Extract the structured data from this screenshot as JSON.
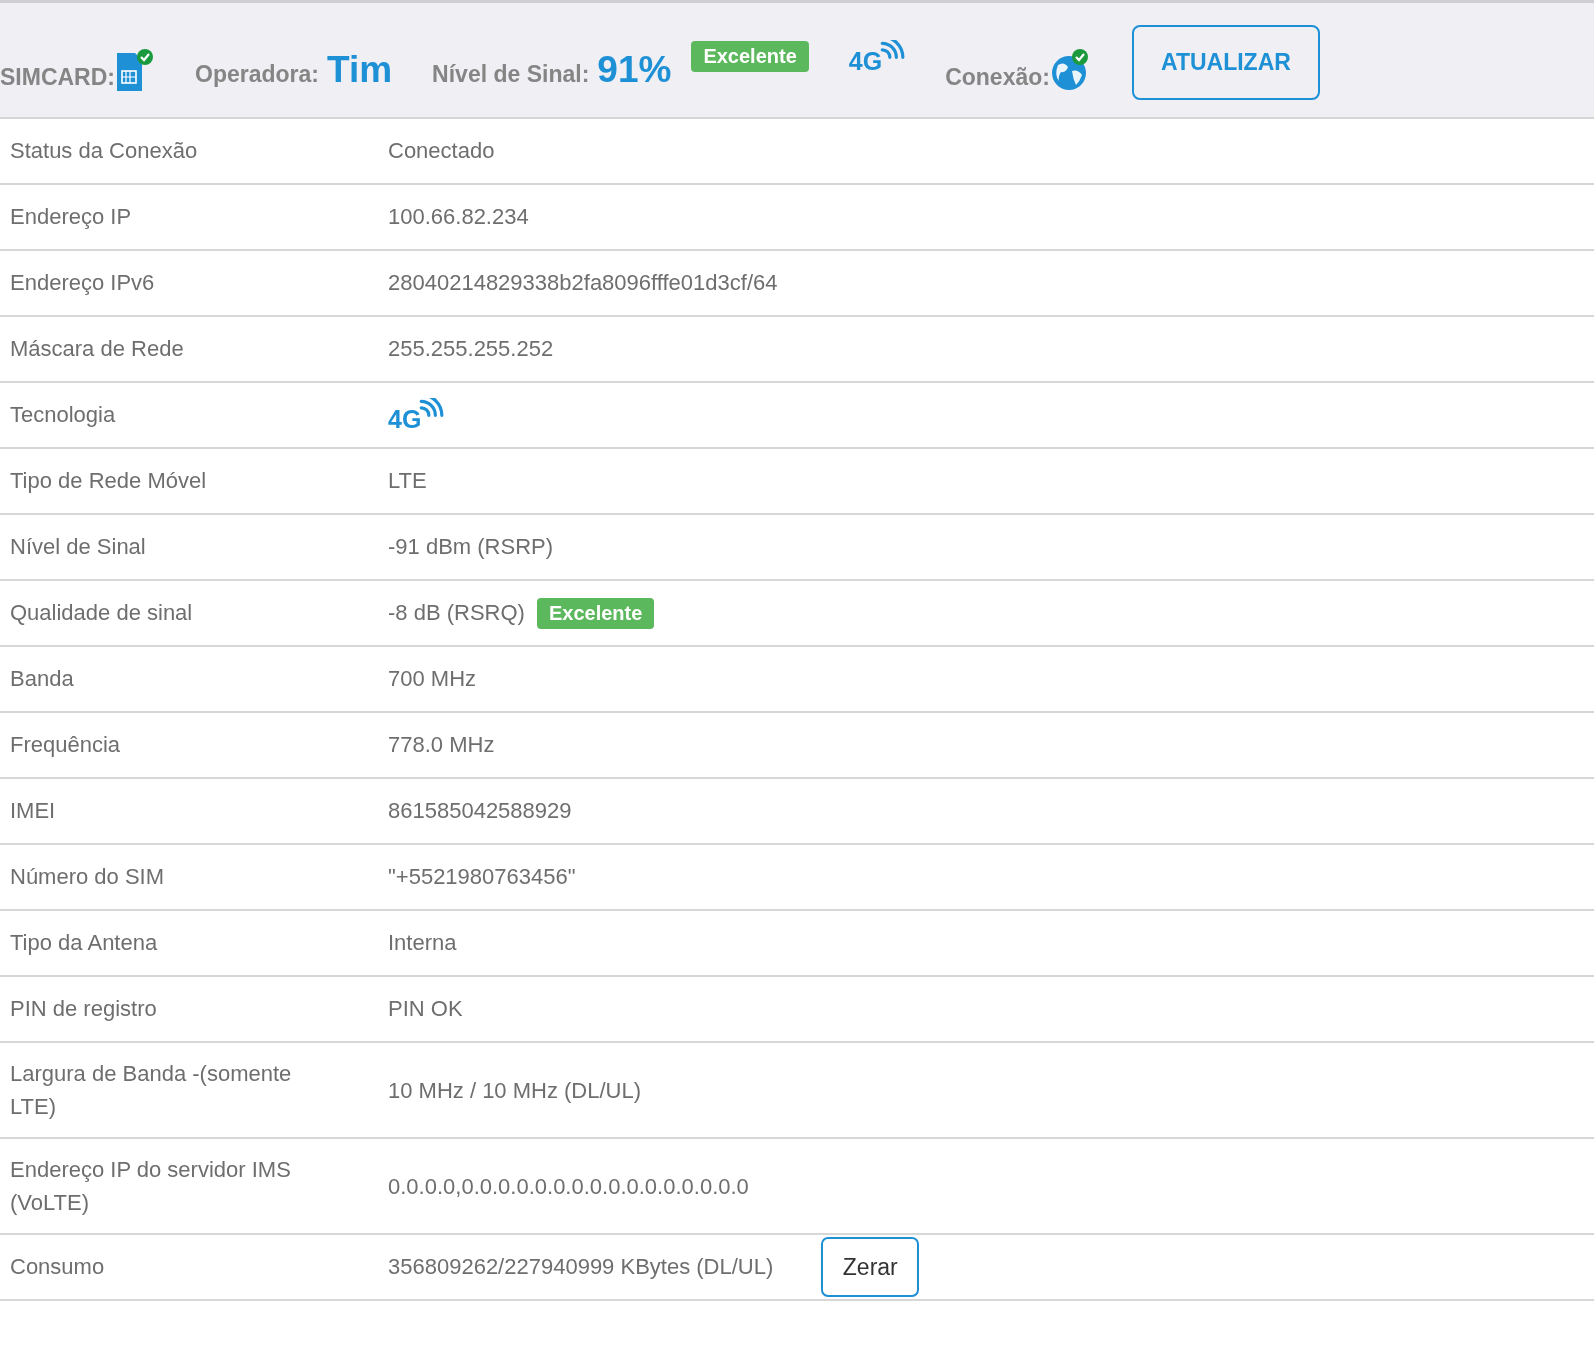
{
  "header": {
    "simcard": {
      "label": "SIMCARD:",
      "ok": true
    },
    "operator": {
      "label": "Operadora:",
      "value": "Tim"
    },
    "signal": {
      "label": "Nível de Sinal:",
      "value": "91%",
      "badge": "Excelente"
    },
    "technology": "4G",
    "connection": {
      "label": "Conexão:",
      "ok": true
    },
    "refresh_button": "ATUALIZAR"
  },
  "rows": [
    {
      "kind": "text",
      "label": "Status da Conexão",
      "value": "Conectado"
    },
    {
      "kind": "text",
      "label": "Endereço IP",
      "value": "100.66.82.234"
    },
    {
      "kind": "text",
      "label": "Endereço IPv6",
      "value": "28040214829338b2fa8096fffe01d3cf/64"
    },
    {
      "kind": "text",
      "label": "Máscara de Rede",
      "value": "255.255.255.252"
    },
    {
      "kind": "tech",
      "label": "Tecnologia",
      "value": "4G"
    },
    {
      "kind": "text",
      "label": "Tipo de Rede Móvel",
      "value": "LTE"
    },
    {
      "kind": "text",
      "label": "Nível de Sinal",
      "value": "-91 dBm (RSRP)"
    },
    {
      "kind": "badge",
      "label": "Qualidade de sinal",
      "value": "-8 dB (RSRQ)",
      "badge": "Excelente"
    },
    {
      "kind": "text",
      "label": "Banda",
      "value": "700 MHz"
    },
    {
      "kind": "text",
      "label": "Frequência",
      "value": "778.0 MHz"
    },
    {
      "kind": "text",
      "label": "IMEI",
      "value": "861585042588929"
    },
    {
      "kind": "text",
      "label": "Número do SIM",
      "value": "\"+5521980763456\""
    },
    {
      "kind": "text",
      "label": "Tipo da Antena",
      "value": "Interna"
    },
    {
      "kind": "text",
      "label": "PIN de registro",
      "value": "PIN OK"
    },
    {
      "kind": "text",
      "label": "Largura de Banda -(somente LTE)",
      "value": "10 MHz / 10 MHz (DL/UL)"
    },
    {
      "kind": "text",
      "label": "Endereço IP do servidor IMS (VoLTE)",
      "value": "0.0.0.0,0.0.0.0.0.0.0.0.0.0.0.0.0.0.0.0"
    },
    {
      "kind": "button",
      "label": "Consumo",
      "value": "356809262/227940999 KBytes (DL/UL)",
      "button": "Zerar"
    }
  ]
}
